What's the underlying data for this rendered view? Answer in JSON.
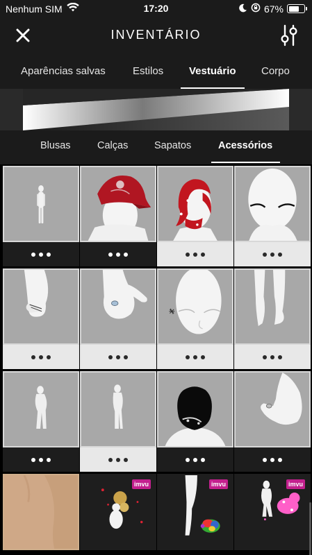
{
  "status": {
    "carrier": "Nenhum SIM",
    "time": "17:20",
    "battery": "67%",
    "battery_level": 0.67
  },
  "header": {
    "title": "INVENTÁRIO"
  },
  "main_tabs": [
    {
      "label": "Aparências salvas"
    },
    {
      "label": "Estilos"
    },
    {
      "label": "Vestuário"
    },
    {
      "label": "Corpo"
    }
  ],
  "sub_tabs": [
    {
      "label": "Blusas"
    },
    {
      "label": "Calças"
    },
    {
      "label": "Sapatos"
    },
    {
      "label": "Acessórios"
    }
  ],
  "badge_text": "imvu",
  "icons": {
    "close": "close-icon",
    "filter": "sliders-icon",
    "wifi": "wifi-icon",
    "moon": "moon-icon",
    "rotation_lock": "rotation-lock-icon",
    "battery": "battery-icon"
  },
  "colors": {
    "accent_badge": "#c3208e",
    "background": "#1b1b1b"
  }
}
